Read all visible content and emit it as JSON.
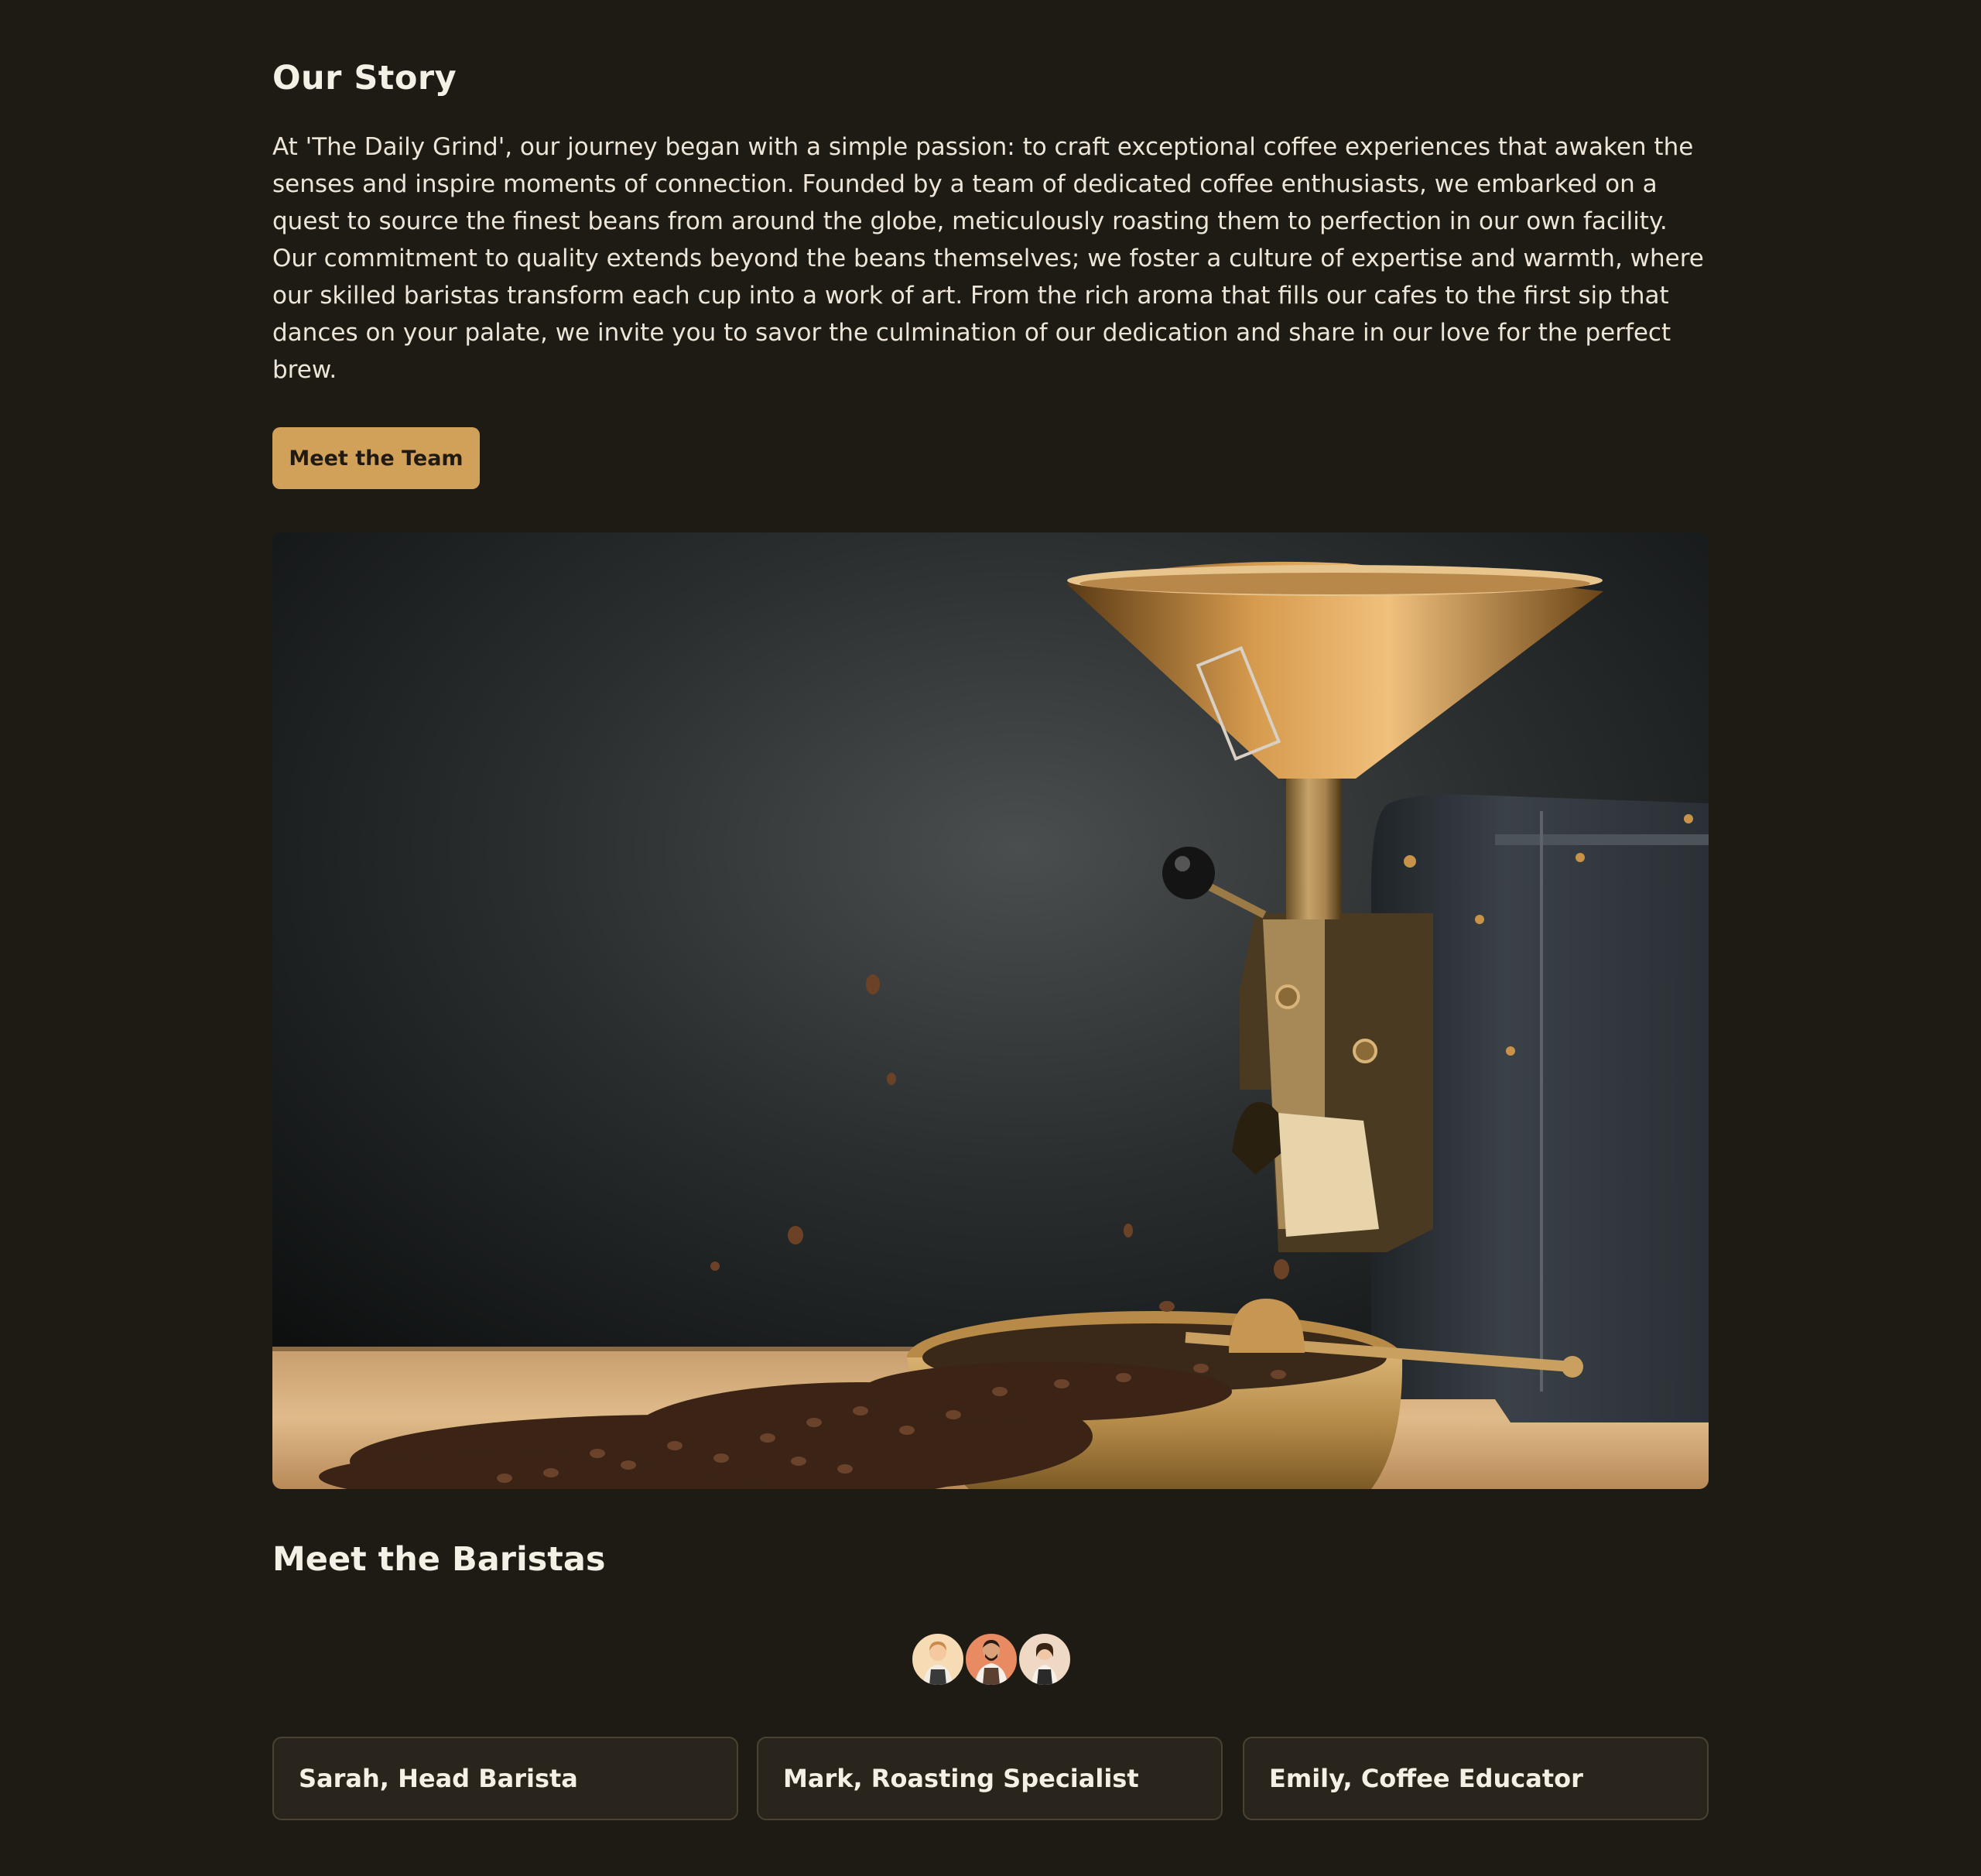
{
  "story": {
    "title": "Our Story",
    "body": "At 'The Daily Grind', our journey began with a simple passion: to craft exceptional coffee experiences that awaken the senses and inspire moments of connection. Founded by a team of dedicated coffee enthusiasts, we embarked on a quest to source the finest beans from around the globe, meticulously roasting them to perfection in our own facility. Our commitment to quality extends beyond the beans themselves; we foster a culture of expertise and warmth, where our skilled baristas transform each cup into a work of art. From the rich aroma that fills our cafes to the first sip that dances on your palate, we invite you to savor the culmination of our dedication and share in our love for the perfect brew.",
    "cta_label": "Meet the Team"
  },
  "hero": {
    "image_name": "coffee-roaster-photo"
  },
  "baristas": {
    "title": "Meet the Baristas",
    "avatars": [
      "barista-avatar-female",
      "barista-avatar-male",
      "barista-avatar-female-2"
    ],
    "cards": [
      {
        "label": "Sarah, Head Barista"
      },
      {
        "label": "Mark, Roasting Specialist"
      },
      {
        "label": "Emily, Coffee Educator"
      }
    ]
  },
  "colors": {
    "background": "#1e1a14",
    "accent": "#d2a159",
    "card_bg": "#2a251c",
    "card_border": "#4a4233",
    "text": "#f5f0e6"
  }
}
